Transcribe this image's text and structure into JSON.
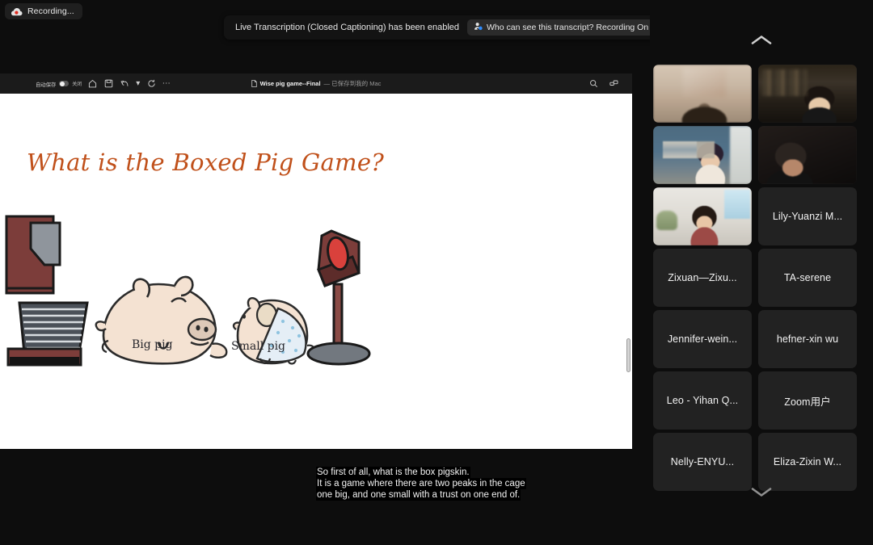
{
  "recording": {
    "label": "Recording...",
    "icon": "cloud-record-icon"
  },
  "toast": {
    "message": "Live Transcription (Closed Captioning) has been enabled",
    "pill_icon": "person-check-icon",
    "pill_text": "Who can see this transcript? Recording On",
    "close_icon": "close-icon"
  },
  "shared_document": {
    "autosave_label": "自动保存",
    "autosave_state": "关闭",
    "toolbar_icons": [
      "home-icon",
      "save-icon",
      "undo-icon",
      "undo-dropdown-icon",
      "redo-icon",
      "more-options-icon"
    ],
    "doc_icon": "document-icon",
    "title": "Wise pig game--Final",
    "saved_status": "— 已保存到我的 Mac",
    "right_icons": [
      "search-icon",
      "share-icon"
    ]
  },
  "slide": {
    "title": "What is the Boxed Pig Game?",
    "title_color": "#c0501a",
    "labels": {
      "big_pig": "Big pig",
      "small_pig": "Small pig"
    },
    "illustration_parts": [
      "feeding-trough",
      "big-pig",
      "small-pig",
      "lever-button"
    ]
  },
  "captions": [
    "So first of all, what is the box pigskin.",
    "It is a game where there are two peaks in the cage",
    "one big, and one small with a trust on one end of."
  ],
  "gallery": {
    "scroll_up_icon": "chevron-up-icon",
    "scroll_down_icon": "chevron-down-icon",
    "tiles": [
      {
        "type": "video",
        "video": "vid-a",
        "name": ""
      },
      {
        "type": "video",
        "video": "vid-b",
        "name": ""
      },
      {
        "type": "video",
        "video": "vid-c",
        "name": ""
      },
      {
        "type": "video",
        "video": "vid-d",
        "name": ""
      },
      {
        "type": "video",
        "video": "vid-e",
        "name": ""
      },
      {
        "type": "name",
        "video": "",
        "name": "Lily-Yuanzi M..."
      },
      {
        "type": "name",
        "video": "",
        "name": "Zixuan—Zixu..."
      },
      {
        "type": "name",
        "video": "",
        "name": "TA-serene"
      },
      {
        "type": "name",
        "video": "",
        "name": "Jennifer-wein..."
      },
      {
        "type": "name",
        "video": "",
        "name": "hefner-xin wu"
      },
      {
        "type": "name",
        "video": "",
        "name": "Leo - Yihan Q..."
      },
      {
        "type": "name",
        "video": "",
        "name": "Zoom用户"
      },
      {
        "type": "name",
        "video": "",
        "name": "Nelly-ENYU..."
      },
      {
        "type": "name",
        "video": "",
        "name": "Eliza-Zixin W..."
      }
    ]
  }
}
